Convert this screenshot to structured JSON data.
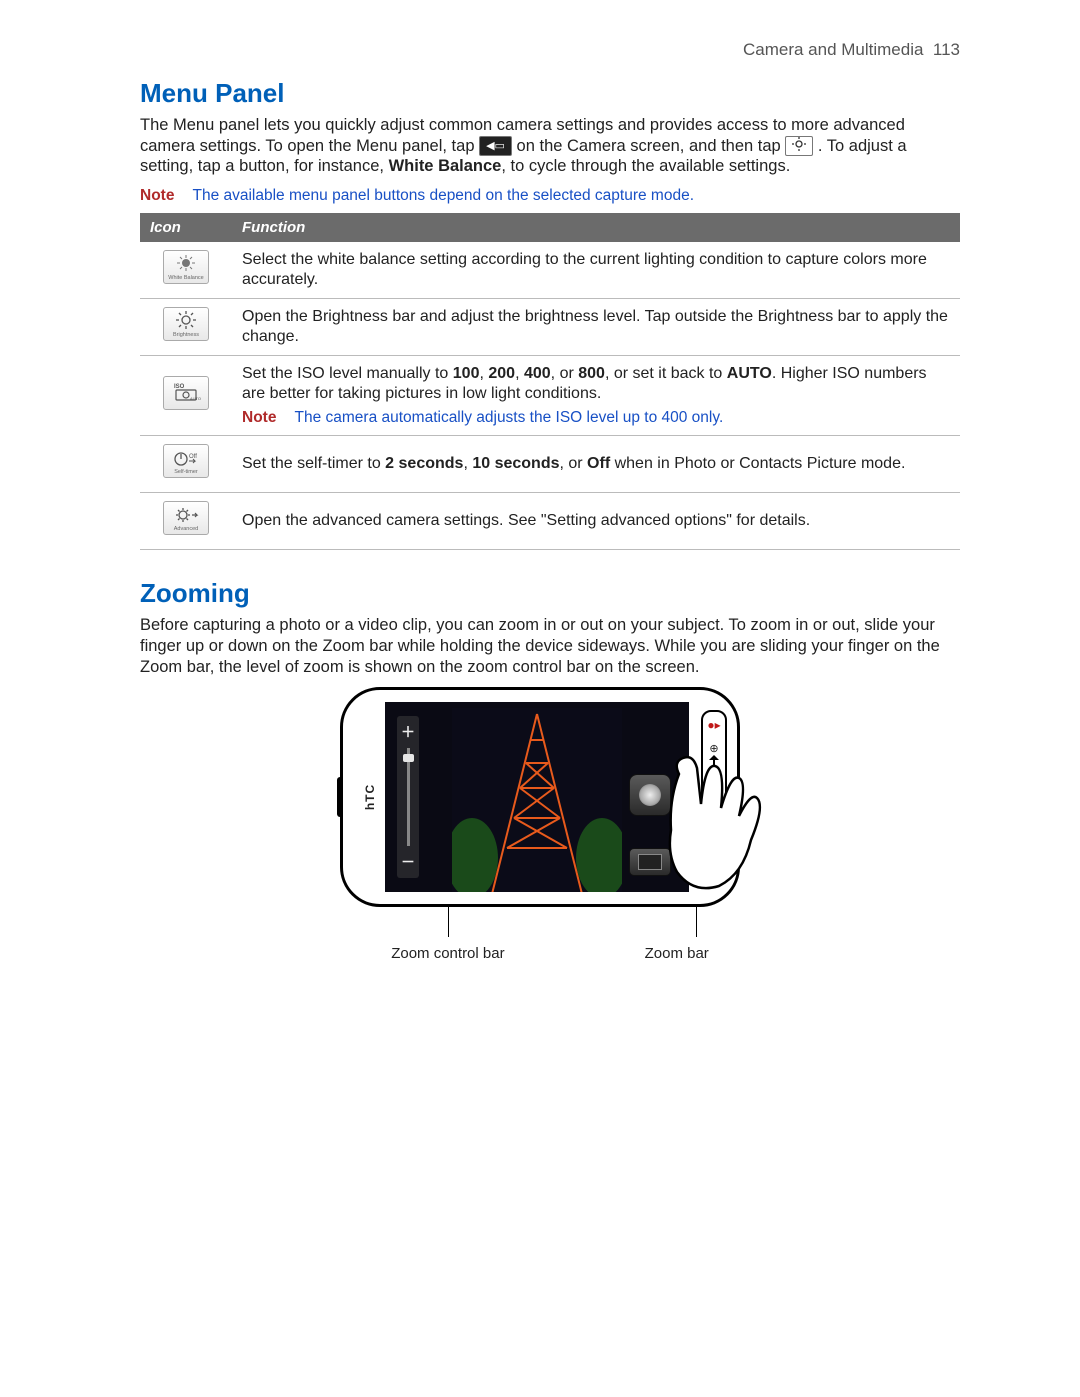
{
  "header": {
    "section": "Camera and Multimedia",
    "page_no": "113"
  },
  "menu_panel": {
    "heading": "Menu Panel",
    "intro_a": "The Menu panel lets you quickly adjust common camera settings and provides access to more advanced camera settings. To open the Menu panel, tap ",
    "intro_b": " on the Camera screen, and then tap ",
    "intro_c": ". To adjust a setting, tap a button, for instance, ",
    "intro_bold": "White Balance",
    "intro_d": ", to cycle through the available settings.",
    "note_label": "Note",
    "note_text": "The available menu panel buttons depend on the selected capture mode.",
    "table": {
      "col_icon": "Icon",
      "col_fn": "Function",
      "rows": [
        {
          "icon_name": "white-balance-icon",
          "icon_label": "White Balance",
          "desc": "Select the white balance setting according to the current lighting condition to capture colors more accurately."
        },
        {
          "icon_name": "brightness-icon",
          "icon_label": "Brightness",
          "desc": "Open the Brightness bar and adjust the brightness level. Tap outside the Brightness bar to apply the change."
        },
        {
          "icon_name": "iso-icon",
          "icon_label": "ISO",
          "desc_a": "Set the ISO level manually to ",
          "b1": "100",
          "s1": ", ",
          "b2": "200",
          "s2": ", ",
          "b3": "400",
          "s3": ", or ",
          "b4": "800",
          "desc_b": ", or set it back to ",
          "b5": "AUTO",
          "desc_c": ". Higher ISO numbers are better for taking pictures in low light conditions.",
          "note": "The camera automatically adjusts the ISO level up to 400 only."
        },
        {
          "icon_name": "self-timer-icon",
          "icon_label": "Self-timer",
          "desc_a": "Set the self-timer to ",
          "b1": "2 seconds",
          "s1": ", ",
          "b2": "10 seconds",
          "desc_b": ", or ",
          "b3": "Off",
          "desc_c": " when in Photo or Contacts Picture mode."
        },
        {
          "icon_name": "advanced-icon",
          "icon_label": "Advanced",
          "desc": "Open the advanced camera settings. See \"Setting advanced options\" for details."
        }
      ]
    }
  },
  "zooming": {
    "heading": "Zooming",
    "body": "Before capturing a photo or a video clip, you can zoom in or out on your subject. To zoom in or out, slide your finger up or down on the Zoom bar while holding the device sideways. While you are sliding your finger on the Zoom bar, the level of zoom is shown on the zoom control bar on the screen.",
    "brand": "hTC",
    "label_left": "Zoom control bar",
    "label_right": "Zoom bar"
  }
}
